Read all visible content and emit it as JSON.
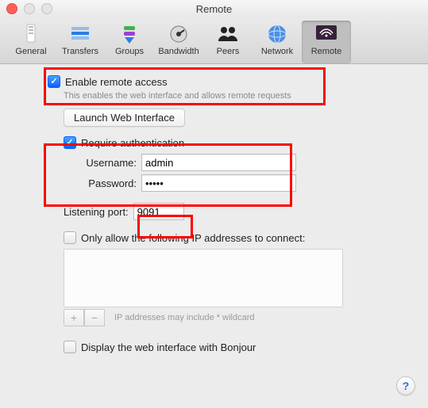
{
  "window": {
    "title": "Remote"
  },
  "toolbar": {
    "items": [
      {
        "label": "General",
        "icon": "general-icon"
      },
      {
        "label": "Transfers",
        "icon": "transfers-icon"
      },
      {
        "label": "Groups",
        "icon": "groups-icon"
      },
      {
        "label": "Bandwidth",
        "icon": "bandwidth-icon"
      },
      {
        "label": "Peers",
        "icon": "peers-icon"
      },
      {
        "label": "Network",
        "icon": "network-icon"
      },
      {
        "label": "Remote",
        "icon": "remote-icon"
      }
    ],
    "selected": "Remote"
  },
  "remote": {
    "enable_label": "Enable remote access",
    "enable_checked": true,
    "enable_desc": "This enables the web interface and allows remote requests",
    "launch_button": "Launch Web Interface",
    "auth": {
      "require_label": "Require authentication",
      "require_checked": true,
      "username_label": "Username:",
      "username_value": "admin",
      "password_label": "Password:",
      "password_value": "•••••"
    },
    "port": {
      "label": "Listening port:",
      "value": "9091"
    },
    "ip": {
      "only_allow_label": "Only allow the following IP addresses to connect:",
      "only_allow_checked": false,
      "hint": "IP addresses may include * wildcard",
      "add_label": "+",
      "remove_label": "−"
    },
    "bonjour": {
      "label": "Display the web interface with Bonjour",
      "checked": false
    }
  },
  "help": {
    "label": "?"
  }
}
